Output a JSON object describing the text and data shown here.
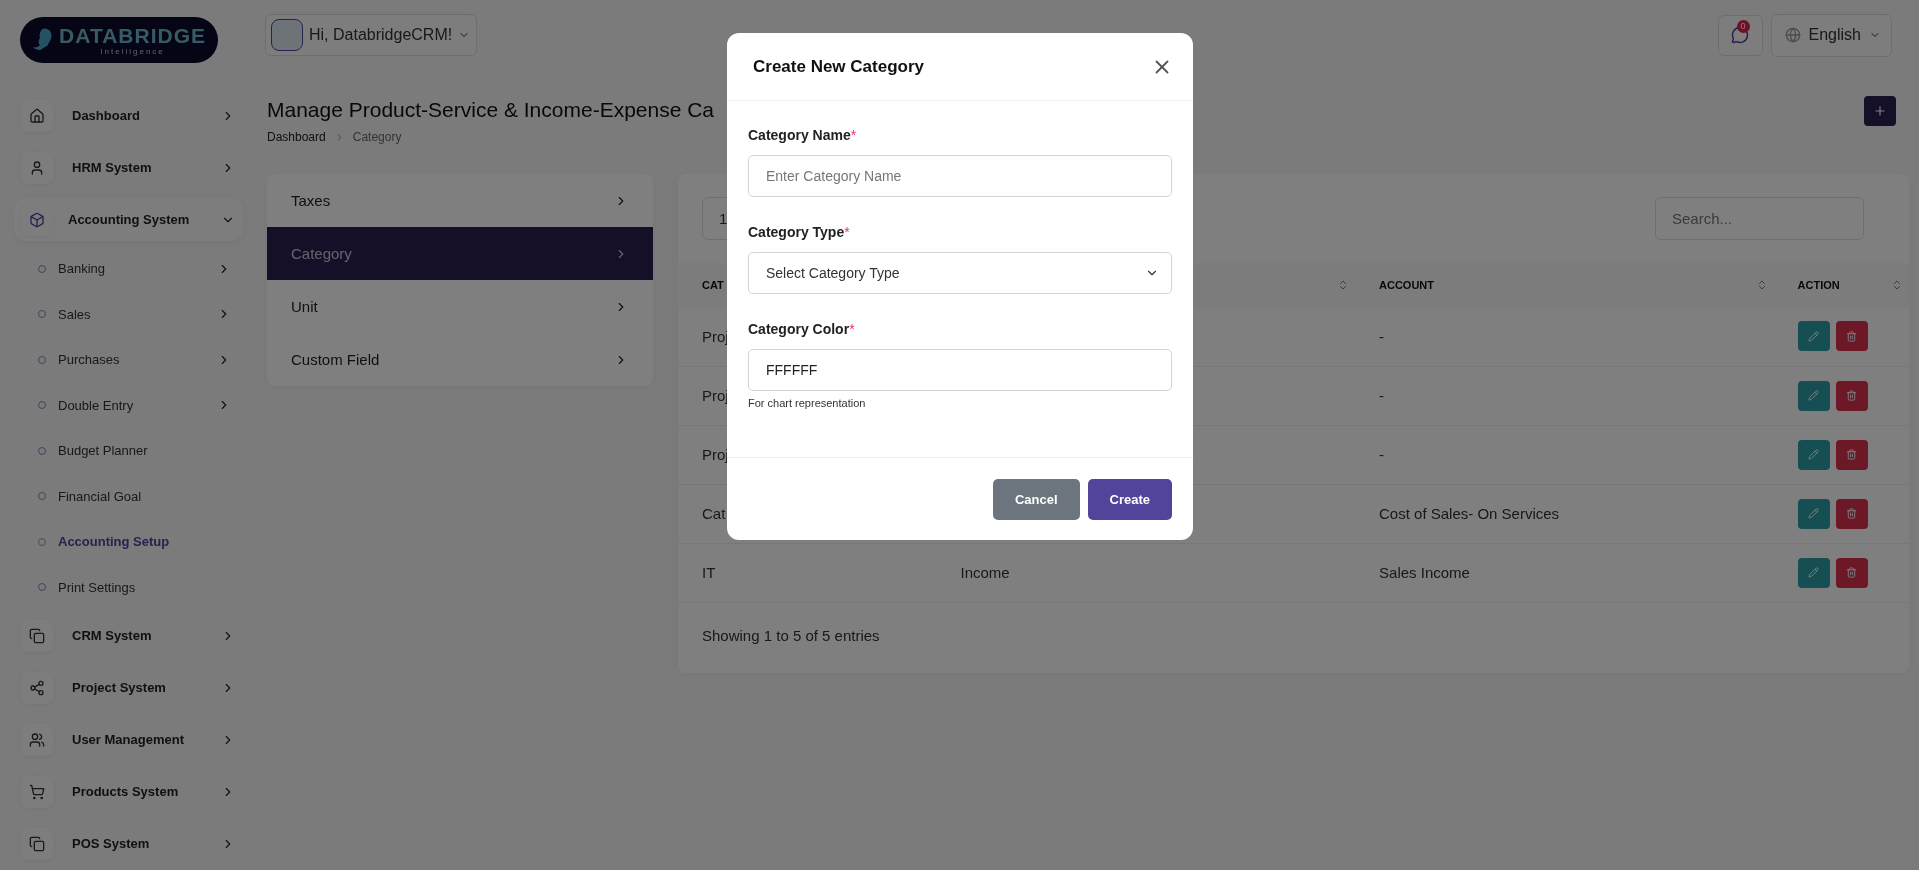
{
  "logo": {
    "name": "DATABRIDGE",
    "tagline": "Intelligence"
  },
  "header": {
    "greeting": "Hi, DatabridgeCRM!",
    "notification_count": "0",
    "language": "English"
  },
  "sidebar": {
    "items": [
      {
        "label": "Dashboard",
        "expanded": false,
        "selected": false
      },
      {
        "label": "HRM System",
        "expanded": false,
        "selected": false
      },
      {
        "label": "Accounting System",
        "expanded": true,
        "selected": true,
        "children": [
          {
            "label": "Banking",
            "kind": "submenu",
            "selected": false
          },
          {
            "label": "Sales",
            "kind": "submenu",
            "selected": false
          },
          {
            "label": "Purchases",
            "kind": "submenu",
            "selected": false
          },
          {
            "label": "Double Entry",
            "kind": "submenu",
            "selected": false
          },
          {
            "label": "Budget Planner",
            "kind": "link",
            "selected": false
          },
          {
            "label": "Financial Goal",
            "kind": "link",
            "selected": false
          },
          {
            "label": "Accounting Setup",
            "kind": "link",
            "selected": true
          },
          {
            "label": "Print Settings",
            "kind": "link",
            "selected": false
          }
        ]
      },
      {
        "label": "CRM System",
        "expanded": false,
        "selected": false
      },
      {
        "label": "Project System",
        "expanded": false,
        "selected": false
      },
      {
        "label": "User Management",
        "expanded": false,
        "selected": false
      },
      {
        "label": "Products System",
        "expanded": false,
        "selected": false
      },
      {
        "label": "POS System",
        "expanded": false,
        "selected": false
      }
    ]
  },
  "page": {
    "title": "Manage Product-Service & Income-Expense Ca",
    "breadcrumb": [
      "Dashboard",
      "Category"
    ]
  },
  "settings_menu": [
    {
      "label": "Taxes",
      "selected": false
    },
    {
      "label": "Category",
      "selected": true
    },
    {
      "label": "Unit",
      "selected": false
    },
    {
      "label": "Custom Field",
      "selected": false
    }
  ],
  "table": {
    "entries_value": "1",
    "search_placeholder": "Search...",
    "columns": [
      {
        "label": "CAT"
      },
      {
        "sort": true
      },
      {
        "label": "ACCOUNT",
        "sort": true
      },
      {
        "label": "ACTION",
        "sort": true
      }
    ],
    "rows": [
      {
        "column_1": "Proj",
        "account": "-"
      },
      {
        "column_1": "Proj",
        "account": "-"
      },
      {
        "column_1": "Proj",
        "account": "-"
      },
      {
        "column_1": "Cat",
        "account": "Cost of Sales- On Services"
      },
      {
        "column_1": "IT",
        "column_2": "Income",
        "account": "Sales Income"
      }
    ],
    "footer": "Showing 1 to 5 of 5 entries"
  },
  "modal": {
    "title": "Create New Category",
    "fields": [
      {
        "kind": "text",
        "label": "Category Name",
        "required_mark": "*",
        "placeholder": "Enter Category Name"
      },
      {
        "kind": "select",
        "label": "Category Type",
        "required_mark": "*",
        "placeholder": "Select Category Type"
      },
      {
        "kind": "text",
        "label": "Category Color",
        "required_mark": "*",
        "value": "FFFFFF",
        "help": "For chart representation"
      }
    ],
    "buttons": [
      {
        "label": "Cancel",
        "kind": "secondary"
      },
      {
        "label": "Create",
        "kind": "primary"
      }
    ]
  }
}
